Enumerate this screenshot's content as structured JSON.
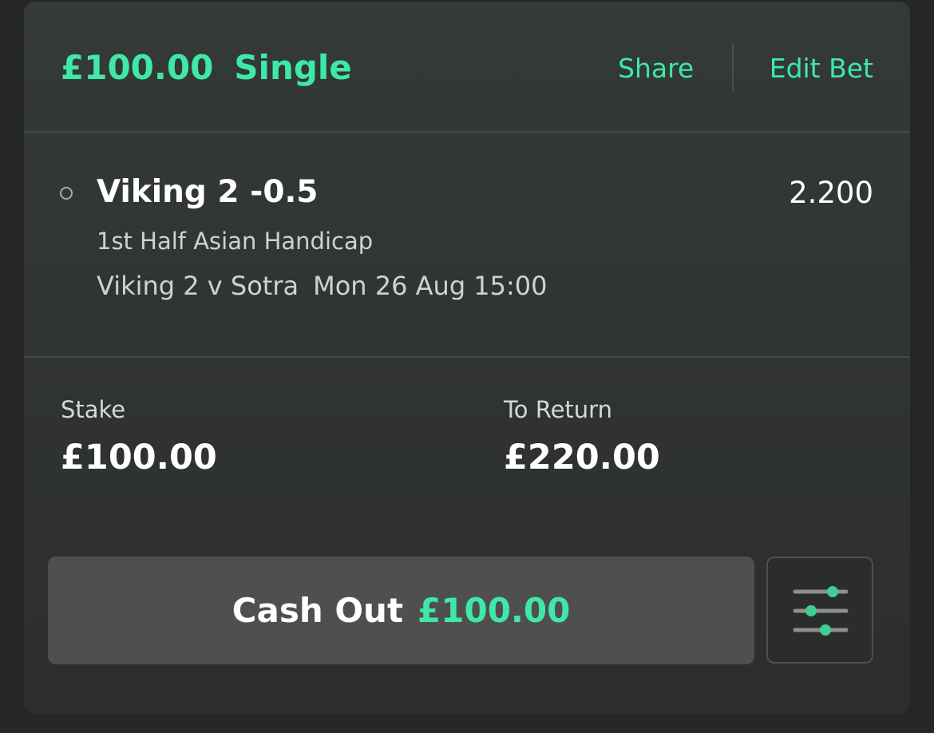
{
  "header": {
    "stake_amount": "£100.00",
    "bet_type": "Single",
    "share_label": "Share",
    "edit_label": "Edit Bet"
  },
  "selection": {
    "name": "Viking 2 -0.5",
    "odds": "2.200",
    "market": "1st Half Asian Handicap",
    "event": "Viking 2 v Sotra",
    "datetime": "Mon 26 Aug 15:00"
  },
  "summary": {
    "stake_label": "Stake",
    "stake_value": "£100.00",
    "return_label": "To Return",
    "return_value": "£220.00"
  },
  "cashout": {
    "label": "Cash Out",
    "amount": "£100.00",
    "settings_icon": "sliders-icon"
  },
  "colors": {
    "accent": "#3ee8a8",
    "card_background": "#303432",
    "page_background": "#262626",
    "cashout_button": "#4f4f4f"
  }
}
